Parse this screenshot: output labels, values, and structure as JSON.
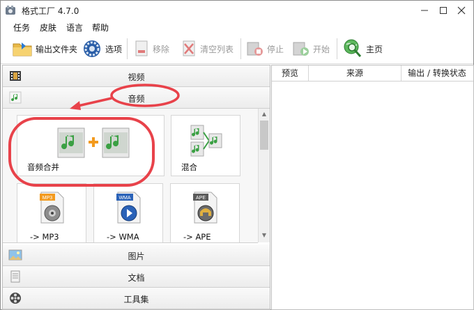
{
  "window": {
    "title": "格式工厂 4.7.0"
  },
  "menu": [
    "任务",
    "皮肤",
    "语言",
    "帮助"
  ],
  "toolbar": {
    "output_folder": "输出文件夹",
    "options": "选项",
    "remove": "移除",
    "clear_list": "清空列表",
    "stop": "停止",
    "start": "开始",
    "home": "主页"
  },
  "categories": {
    "video": "视频",
    "audio": "音频",
    "image": "图片",
    "document": "文档",
    "tools": "工具集"
  },
  "audio_tiles": {
    "merge": "音频合并",
    "mix": "混合",
    "mp3": "-> MP3",
    "wma": "-> WMA",
    "ape": "-> APE"
  },
  "tile_badges": {
    "mp3": "MP3",
    "wma": "WMA",
    "ape": "APE"
  },
  "task_columns": {
    "preview": "预览",
    "source": "来源",
    "status": "输出 / 转换状态"
  },
  "colors": {
    "annotation": "#e8424a",
    "accent_blue": "#1f6fc0",
    "music_green": "#3aa043"
  }
}
